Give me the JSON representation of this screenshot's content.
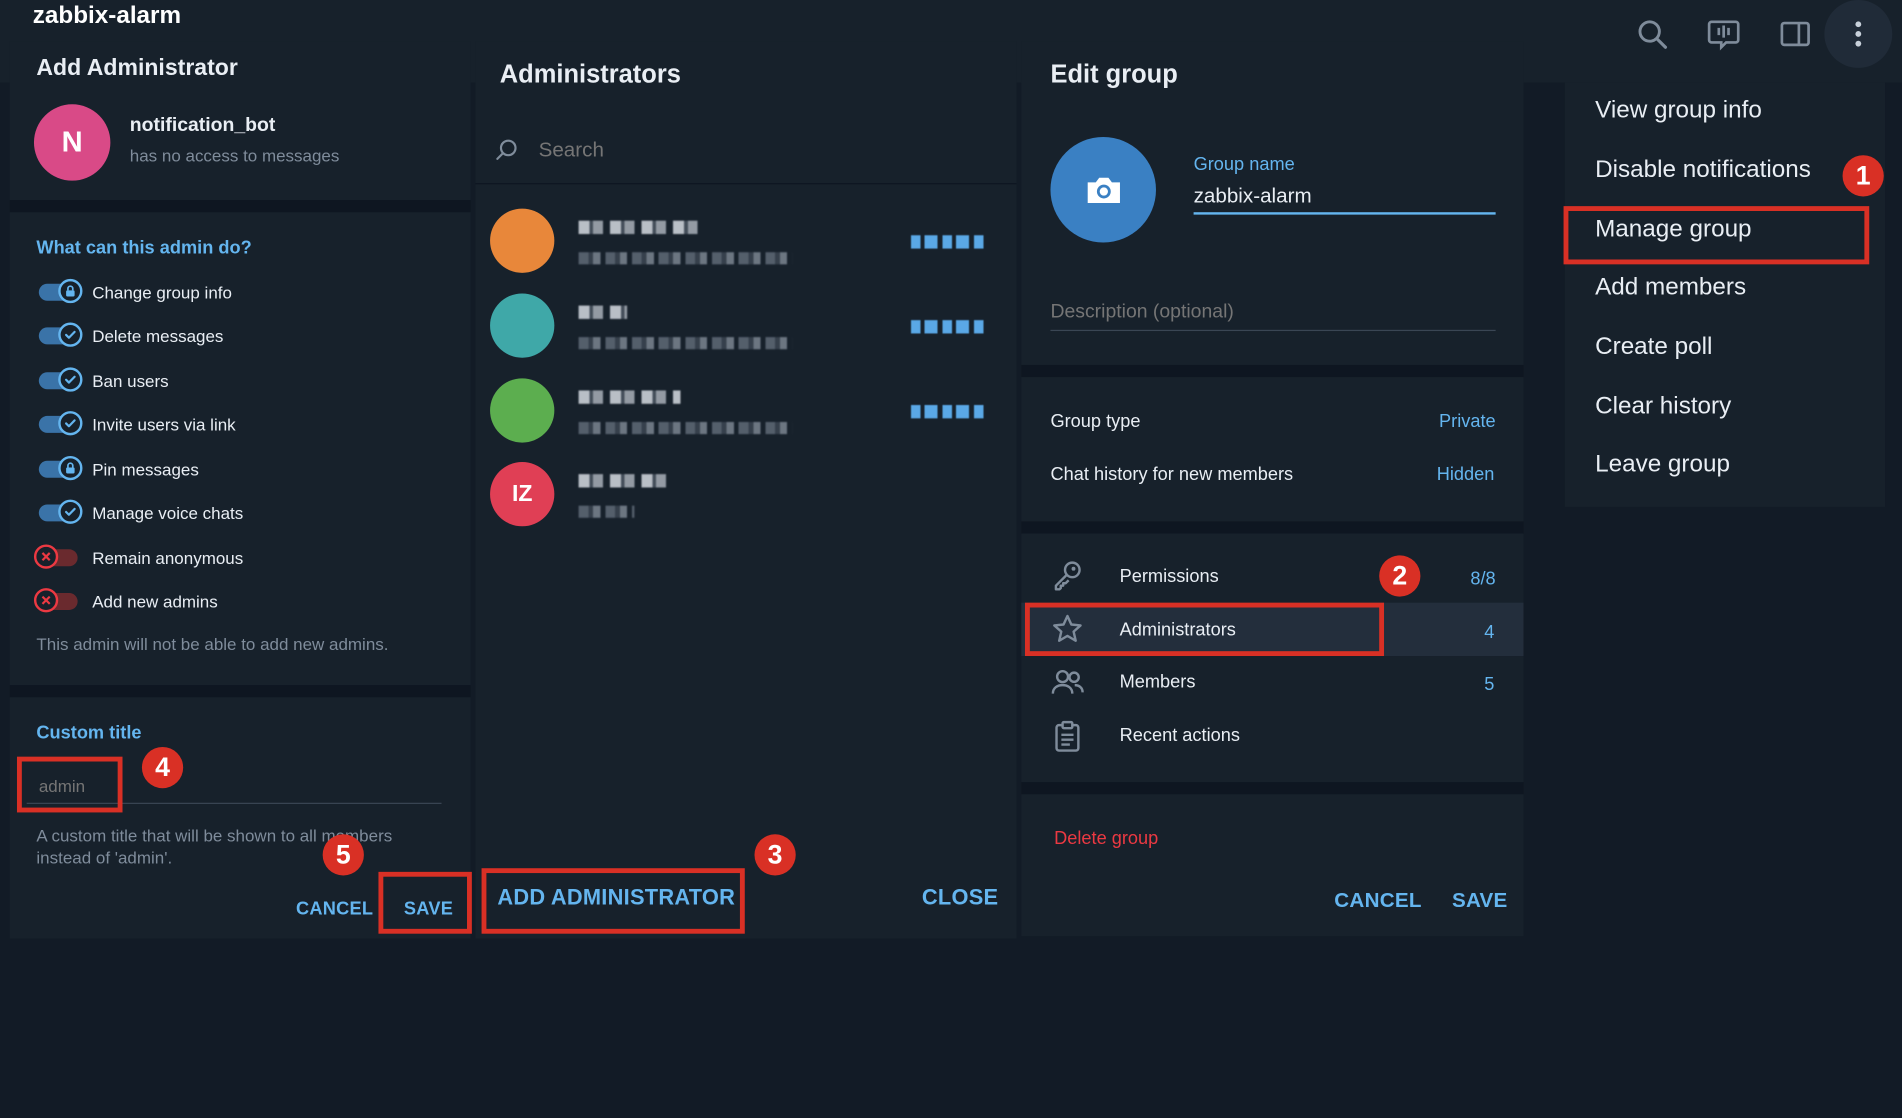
{
  "window": {
    "chat_title": "zabbix-alarm",
    "top_icons": [
      "search-icon",
      "voice-chat-icon",
      "sidebar-toggle-icon",
      "more-vertical-icon"
    ]
  },
  "menu": {
    "items": [
      {
        "label": "View group info"
      },
      {
        "label": "Disable notifications"
      },
      {
        "label": "Manage group"
      },
      {
        "label": "Add members"
      },
      {
        "label": "Create poll"
      },
      {
        "label": "Clear history"
      },
      {
        "label": "Leave group"
      }
    ]
  },
  "add_admin": {
    "title": "Add Administrator",
    "bot": {
      "avatar_letter": "N",
      "name": "notification_bot",
      "status": "has no access to messages"
    },
    "section_title": "What can this admin do?",
    "permissions": [
      {
        "label": "Change group info",
        "state": "on-locked"
      },
      {
        "label": "Delete messages",
        "state": "on"
      },
      {
        "label": "Ban users",
        "state": "on"
      },
      {
        "label": "Invite users via link",
        "state": "on"
      },
      {
        "label": "Pin messages",
        "state": "on-locked"
      },
      {
        "label": "Manage voice chats",
        "state": "on"
      },
      {
        "label": "Remain anonymous",
        "state": "off"
      },
      {
        "label": "Add new admins",
        "state": "off"
      }
    ],
    "note": "This admin will not be able to add new admins.",
    "custom_title_label": "Custom title",
    "custom_title_placeholder": "admin",
    "custom_title_hint": "A custom title that will be shown to all members instead of 'admin'.",
    "cancel_label": "CANCEL",
    "save_label": "SAVE"
  },
  "administrators": {
    "title": "Administrators",
    "search_placeholder": "Search",
    "list": [
      {
        "avatar_color": "#e8873a",
        "avatar_text": ""
      },
      {
        "avatar_color": "#3fa8a8",
        "avatar_text": ""
      },
      {
        "avatar_color": "#5cae4f",
        "avatar_text": ""
      },
      {
        "avatar_color": "#e03f55",
        "avatar_text": "IZ"
      }
    ],
    "add_label": "ADD ADMINISTRATOR",
    "close_label": "CLOSE"
  },
  "edit_group": {
    "title": "Edit group",
    "group_name_label": "Group name",
    "group_name_value": "zabbix-alarm",
    "description_placeholder": "Description (optional)",
    "settings": [
      {
        "label": "Group type",
        "value": "Private"
      },
      {
        "label": "Chat history for new members",
        "value": "Hidden"
      }
    ],
    "sections": [
      {
        "label": "Permissions",
        "value": "8/8",
        "icon": "key-icon"
      },
      {
        "label": "Administrators",
        "value": "4",
        "icon": "star-icon"
      },
      {
        "label": "Members",
        "value": "5",
        "icon": "members-icon"
      },
      {
        "label": "Recent actions",
        "value": "",
        "icon": "clipboard-icon"
      }
    ],
    "delete_label": "Delete group",
    "cancel_label": "CANCEL",
    "save_label": "SAVE"
  },
  "annotations": {
    "badges": [
      "1",
      "2",
      "3",
      "4",
      "5"
    ],
    "color": "#d93025"
  },
  "colors": {
    "accent": "#64b5ef",
    "danger": "#ec3942",
    "panel_bg": "#17212b",
    "app_bg": "#121b26"
  }
}
